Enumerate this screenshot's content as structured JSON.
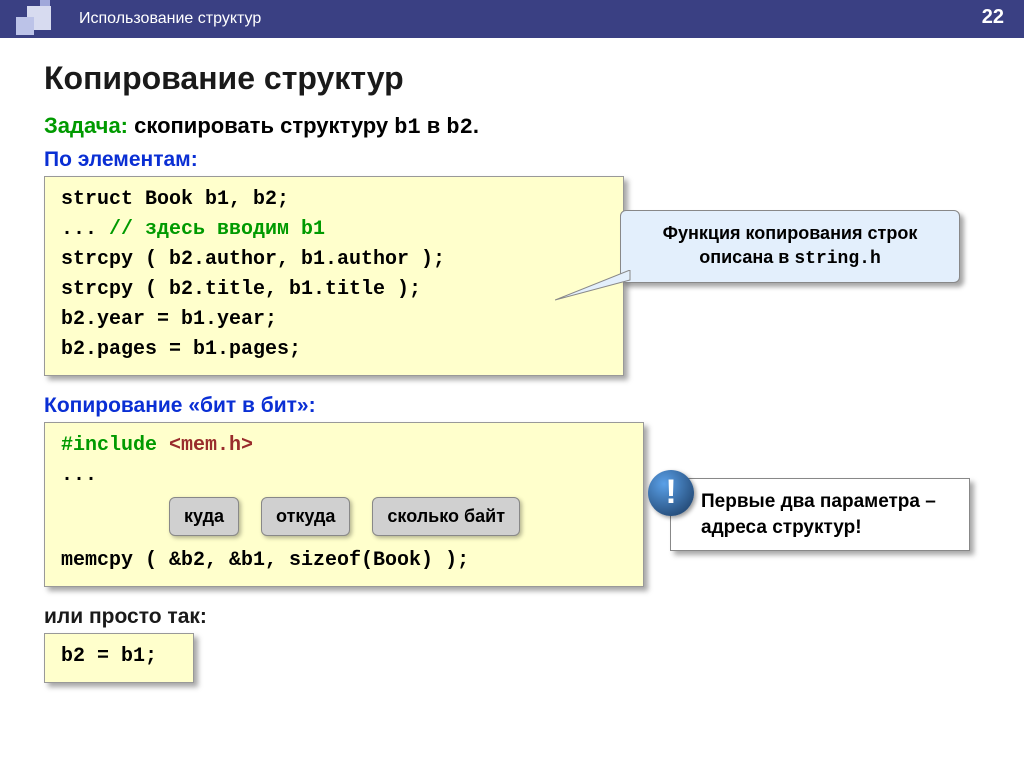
{
  "header": {
    "subtitle": "Использование структур",
    "page_number": "22"
  },
  "title": "Копирование структур",
  "task": {
    "label": "Задача:",
    "text_pre": " скопировать структуру ",
    "b1": "b1",
    "mid": " в ",
    "b2": "b2",
    "end": "."
  },
  "section1": "По элементам:",
  "code1": {
    "l1": "struct Book b1, b2;",
    "l2a": "...   ",
    "l2b": "// здесь вводим b1",
    "l3": "strcpy ( b2.author, b1.author );",
    "l4": "strcpy ( b2.title, b1.title );",
    "l5": "b2.year = b1.year;",
    "l6": "b2.pages = b1.pages;"
  },
  "callout1": {
    "line1": "Функция копирования строк",
    "line2a": "описана в ",
    "line2b": "string.h"
  },
  "section2": "Копирование «бит в бит»:",
  "code2": {
    "l1a": "#include ",
    "l1b": "<mem.h>",
    "l2": "...",
    "l3": "memcpy ( &b2, &b1, sizeof(Book) );"
  },
  "bubbles": {
    "b1": "куда",
    "b2": "откуда",
    "b3": "сколько байт"
  },
  "warn": {
    "mark": "!",
    "text": "Первые два параметра – адреса структур!"
  },
  "section3": "или просто так:",
  "code3": {
    "l1": "b2 = b1;"
  }
}
